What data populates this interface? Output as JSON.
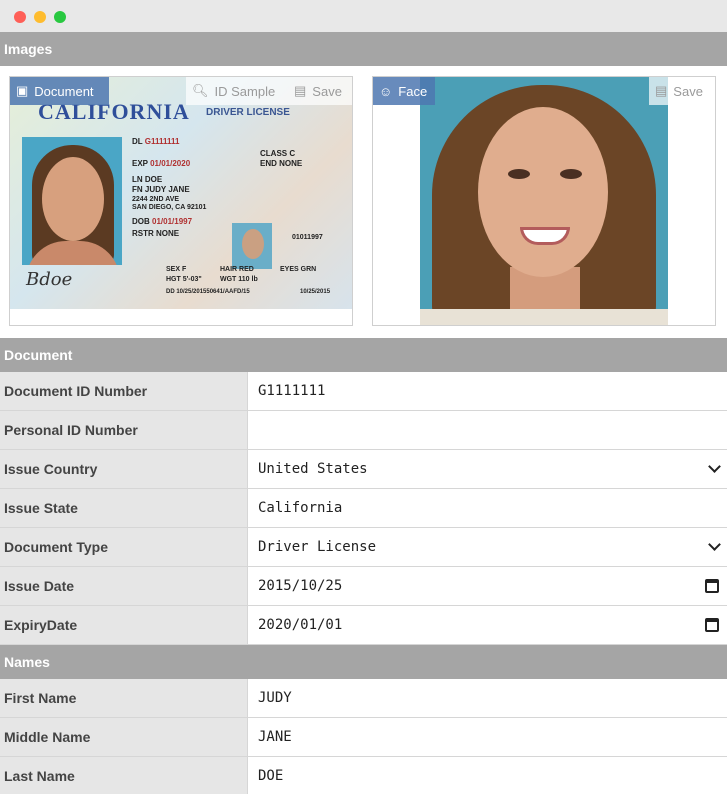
{
  "window": {
    "controls": [
      "close",
      "minimize",
      "maximize"
    ]
  },
  "images_section": {
    "title": "Images",
    "document_panel": {
      "tab_label": "Document",
      "sample_label": "ID Sample",
      "save_label": "Save",
      "card": {
        "state": "CALIFORNIA",
        "type": "DRIVER LICENSE",
        "dl_label": "DL",
        "dl_value": "G1111111",
        "class_label": "CLASS",
        "class_value": "C",
        "exp_label": "EXP",
        "exp_value": "01/01/2020",
        "end_label": "END",
        "end_value": "NONE",
        "ln_label": "LN",
        "ln_value": "DOE",
        "fn_label": "FN",
        "fn_value": "JUDY JANE",
        "address1": "2244 2ND AVE",
        "address2": "SAN DIEGO, CA 92101",
        "dob_label": "DOB",
        "dob_value": "01/01/1997",
        "rstr_label": "RSTR",
        "rstr_value": "NONE",
        "number": "01011997",
        "sex_line": "SEX F",
        "hair_line": "HAIR RED",
        "eyes_line": "EYES GRN",
        "hgt_line": "HGT 5'-03\"",
        "wgt_line": "WGT 110 lb",
        "dd_line": "DD 10/25/201550641/AAFD/15",
        "iss_date": "10/25/2015",
        "signature": "Bdoe"
      }
    },
    "face_panel": {
      "tab_label": "Face",
      "save_label": "Save"
    }
  },
  "document_section": {
    "title": "Document",
    "rows": [
      {
        "label": "Document ID Number",
        "value": "G1111111",
        "control": "text"
      },
      {
        "label": "Personal ID Number",
        "value": "",
        "control": "text"
      },
      {
        "label": "Issue Country",
        "value": "United States",
        "control": "select"
      },
      {
        "label": "Issue State",
        "value": "California",
        "control": "text"
      },
      {
        "label": "Document Type",
        "value": "Driver License",
        "control": "select"
      },
      {
        "label": "Issue Date",
        "value": "2015/10/25",
        "control": "date"
      },
      {
        "label": "ExpiryDate",
        "value": "2020/01/01",
        "control": "date"
      }
    ]
  },
  "names_section": {
    "title": "Names",
    "rows": [
      {
        "label": "First Name",
        "value": "JUDY"
      },
      {
        "label": "Middle Name",
        "value": "JANE"
      },
      {
        "label": "Last Name",
        "value": "DOE"
      }
    ]
  },
  "colors": {
    "section_header_bg": "#a5a5a5",
    "label_bg": "#e6e6e6",
    "tab_accent": "#4e77b0"
  }
}
